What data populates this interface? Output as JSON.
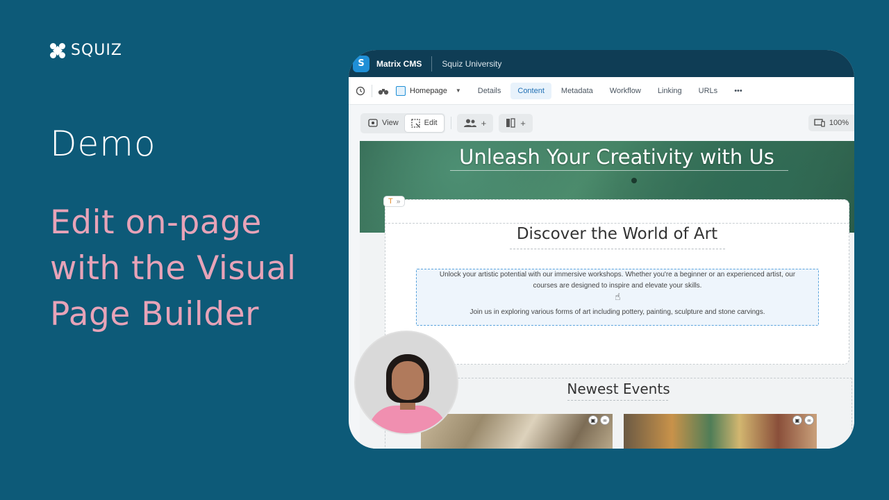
{
  "brand": {
    "name": "SQUIZ"
  },
  "demo_label": "Demo",
  "headline": "Edit on-page with the Visual Page Builder",
  "app": {
    "name": "Matrix CMS",
    "site": "Squiz University",
    "page_selector": "Homepage",
    "tabs": [
      {
        "label": "Details",
        "active": false
      },
      {
        "label": "Content",
        "active": true
      },
      {
        "label": "Metadata",
        "active": false
      },
      {
        "label": "Workflow",
        "active": false
      },
      {
        "label": "Linking",
        "active": false
      },
      {
        "label": "URLs",
        "active": false
      }
    ],
    "more": "•••",
    "view_label": "View",
    "edit_label": "Edit",
    "zoom": "100%"
  },
  "page": {
    "hero_title": "Unleash Your Creativity with Us",
    "component_tag": "T",
    "section_title": "Discover the World of Art",
    "paragraph1": "Unlock your artistic potential with our immersive workshops. Whether you're a beginner or an experienced artist, our courses are designed to inspire and elevate your skills.",
    "paragraph2": "Join us in exploring various forms of art including pottery, painting, sculpture and stone carvings.",
    "events_title": "Newest Events"
  },
  "colors": {
    "background": "#0d5a78",
    "headline": "#e7a3b8",
    "topbar": "#0f3d55",
    "accent": "#1f8fd6"
  }
}
